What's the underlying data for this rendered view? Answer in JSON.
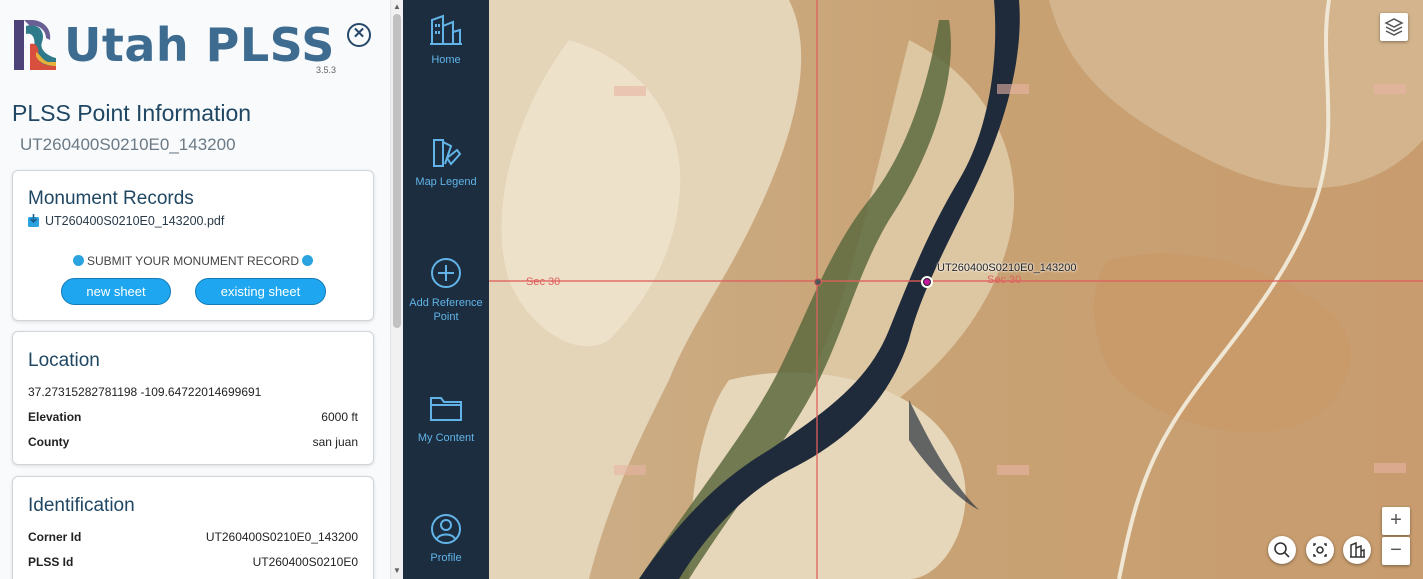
{
  "app": {
    "title": "Utah PLSS",
    "version": "3.5.3"
  },
  "panel": {
    "title": "PLSS Point Information",
    "point_id": "UT260400S0210E0_143200",
    "monument": {
      "title": "Monument Records",
      "pdf": "UT260400S0210E0_143200.pdf",
      "submit_label": "SUBMIT YOUR MONUMENT RECORD",
      "new_sheet": "new sheet",
      "existing_sheet": "existing sheet"
    },
    "location": {
      "title": "Location",
      "coords": "37.27315282781198  -109.64722014699691",
      "elevation_label": "Elevation",
      "elevation_value": "6000 ft",
      "county_label": "County",
      "county_value": "san juan"
    },
    "identification": {
      "title": "Identification",
      "corner_label": "Corner Id",
      "corner_value": "UT260400S0210E0_143200",
      "plss_label": "PLSS Id",
      "plss_value": "UT260400S0210E0"
    }
  },
  "nav": [
    {
      "label": "Home",
      "icon": "home-icon"
    },
    {
      "label": "Map Legend",
      "icon": "legend-icon"
    },
    {
      "label": "Add Reference Point",
      "icon": "add-circle-icon"
    },
    {
      "label": "My Content",
      "icon": "folder-icon"
    },
    {
      "label": "Profile",
      "icon": "user-icon"
    }
  ],
  "map": {
    "point_label": "UT260400S0210E0_143200",
    "section_label_left": "Sec 30",
    "section_label_right": "Sec 30",
    "line_color": "#e0605d",
    "point_color": "#c4169e"
  }
}
